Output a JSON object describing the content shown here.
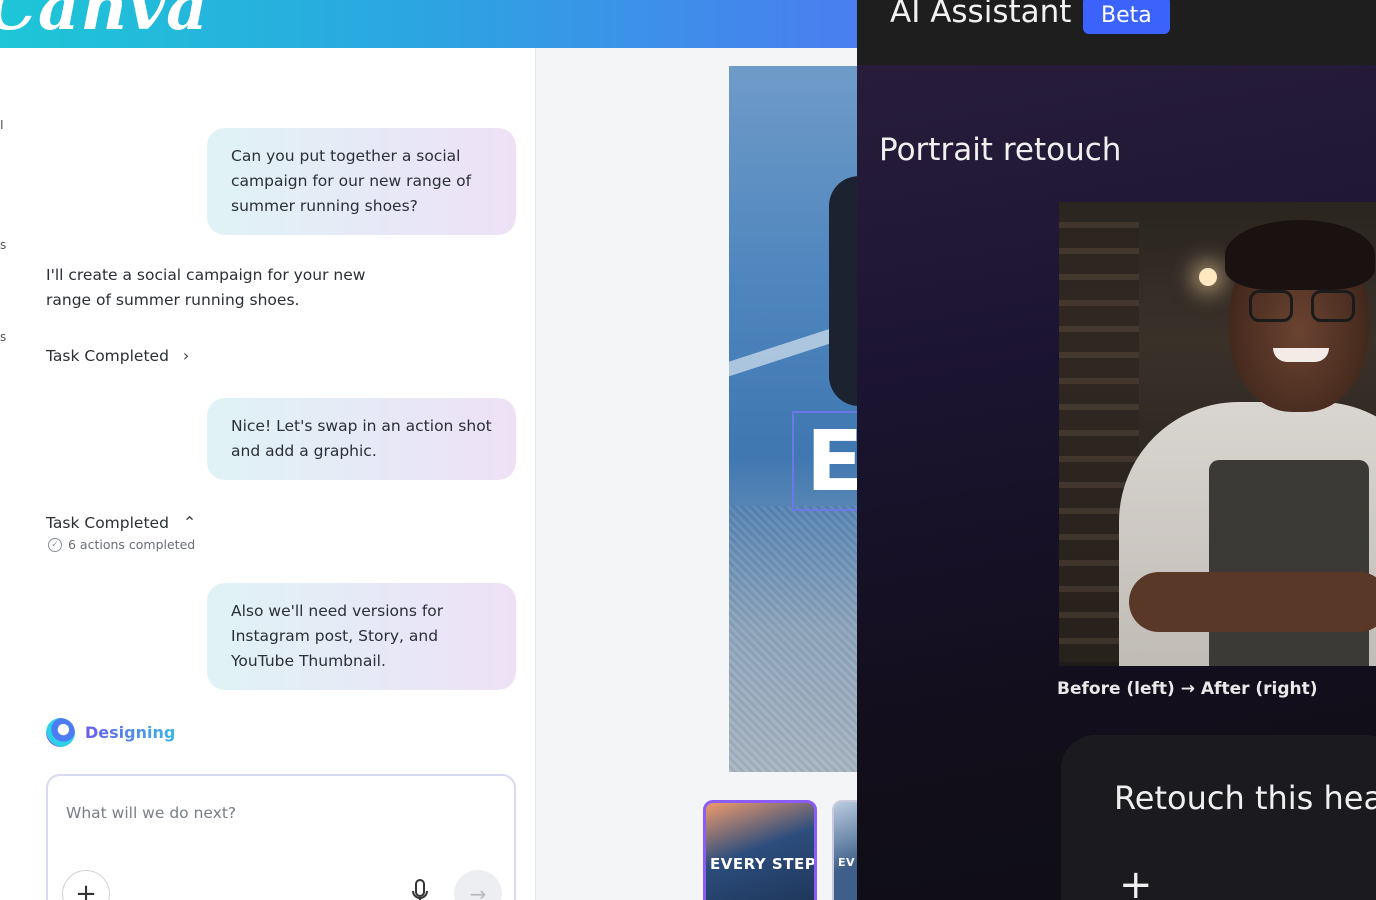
{
  "canva": {
    "logo_text": "Canva",
    "rail_marks": [
      "I",
      "s",
      "s"
    ],
    "messages": [
      {
        "role": "user",
        "text": "Can you put together a social campaign for our new range of summer running shoes?"
      },
      {
        "role": "assistant",
        "text": "I'll create a social campaign for your new range of summer running shoes."
      },
      {
        "role": "task",
        "label": "Task Completed",
        "expanded": false
      },
      {
        "role": "user",
        "text": "Nice! Let's swap in an action shot and add a graphic."
      },
      {
        "role": "task",
        "label": "Task Completed",
        "expanded": true,
        "sub": "6 actions completed"
      },
      {
        "role": "user",
        "text": "Also we'll need versions for Instagram post, Story, and YouTube Thumbnail."
      }
    ],
    "status": "Designing",
    "prompt": {
      "placeholder": "What will we do next?",
      "value": ""
    },
    "preview_letter": "E",
    "thumbnails": [
      {
        "label": "EVERY STEP",
        "selected": true
      },
      {
        "label": "EV",
        "selected": false
      }
    ],
    "colors": {
      "header_start": "#1ec6d7",
      "header_end": "#4a7ef0",
      "thumb_selected": "#8b5cf6"
    }
  },
  "adobe": {
    "title": "AI Assistant",
    "badge": "Beta",
    "section_title": "Portrait retouch",
    "caption": "Before (left) → After (right)",
    "prompt_text": "Retouch this head",
    "colors": {
      "badge": "#3b63fb",
      "header": "#1e1e1e"
    }
  }
}
